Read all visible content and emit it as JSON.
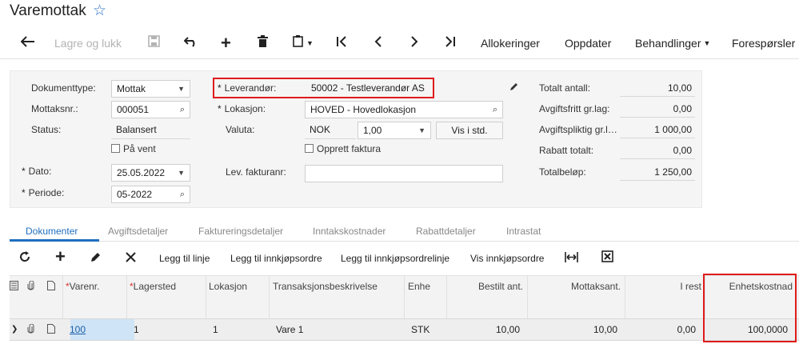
{
  "header": {
    "title": "Varemottak"
  },
  "toolbar": {
    "save_close": "Lagre og lukk",
    "allocations": "Allokeringer",
    "update": "Oppdater",
    "actions": "Behandlinger",
    "inquiries": "Forespørsler"
  },
  "form": {
    "doc_type": {
      "label": "Dokumenttype:",
      "value": "Mottak"
    },
    "receipt_no": {
      "label": "Mottaksnr.:",
      "value": "000051"
    },
    "status": {
      "label": "Status:",
      "value": "Balansert"
    },
    "on_hold": {
      "label": "På vent"
    },
    "date": {
      "label": "Dato:",
      "value": "25.05.2022"
    },
    "period": {
      "label": "Periode:",
      "value": "05-2022"
    },
    "supplier": {
      "label": "Leverandør:",
      "value": "50002 - Testleverandør AS"
    },
    "location": {
      "label": "Lokasjon:",
      "value": "HOVED - Hovedlokasjon"
    },
    "currency": {
      "label": "Valuta:",
      "value": "NOK",
      "rate": "1,00",
      "button": "Vis i std."
    },
    "create_invoice": {
      "label": "Opprett faktura"
    },
    "supplier_invoice": {
      "label": "Lev. fakturanr:",
      "value": ""
    },
    "totals": [
      {
        "label": "Totalt antall:",
        "value": "10,00"
      },
      {
        "label": "Avgiftsfritt gr.lag:",
        "value": "0,00"
      },
      {
        "label": "Avgiftspliktig gr.l…",
        "value": "1 000,00"
      },
      {
        "label": "Rabatt totalt:",
        "value": "0,00"
      },
      {
        "label": "Totalbeløp:",
        "value": "1 250,00"
      }
    ]
  },
  "tabs": [
    "Dokumenter",
    "Avgiftsdetaljer",
    "Faktureringsdetaljer",
    "Inntakskostnader",
    "Rabattdetaljer",
    "Intrastat"
  ],
  "grid_toolbar": {
    "add_line": "Legg til linje",
    "add_po": "Legg til innkjøpsordre",
    "add_po_line": "Legg til innkjøpsordrelinje",
    "view_po": "Vis innkjøpsordre"
  },
  "grid": {
    "columns": [
      "Varenr.",
      "Lagersted",
      "Lokasjon",
      "Transaksjonsbeskrivelse",
      "Enhe",
      "Bestilt ant.",
      "Mottaksant.",
      "I rest",
      "Enhetskostnad"
    ],
    "rows": [
      [
        "100",
        "1",
        "1",
        "Vare 1",
        "STK",
        "10,00",
        "10,00",
        "0,00",
        "100,0000"
      ]
    ]
  },
  "colors": {
    "accent": "#1f6fbf",
    "highlight": "#e01b1b",
    "star": "#2a72c8"
  }
}
